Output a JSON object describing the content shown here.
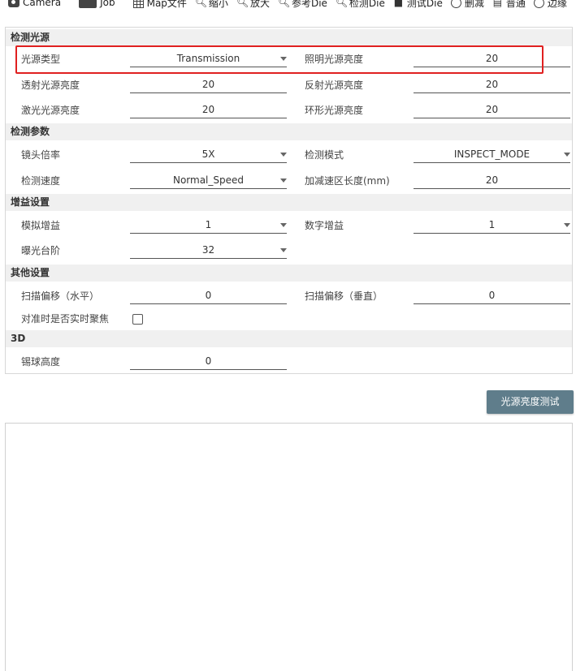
{
  "toolbar": {
    "items": [
      {
        "label": "Camera",
        "icon": "camera-icon"
      },
      {
        "label": "Job",
        "icon": "folder-icon"
      },
      {
        "label": "Map文件",
        "icon": "grid-icon"
      },
      {
        "label": "缩小",
        "icon": "zoom-out-icon"
      },
      {
        "label": "放大",
        "icon": "zoom-in-icon"
      },
      {
        "label": "参考Die",
        "icon": "search-icon"
      },
      {
        "label": "检测Die",
        "icon": "search-icon"
      },
      {
        "label": "测试Die",
        "icon": "bookmark-icon"
      },
      {
        "label": "删减",
        "icon": "minus-circle-icon"
      },
      {
        "label": "普通",
        "icon": "file-icon"
      },
      {
        "label": "边缘",
        "icon": "circle-icon"
      }
    ]
  },
  "sections": {
    "light": {
      "title": "检测光源",
      "light_type_label": "光源类型",
      "light_type_value": "Transmission",
      "illum_label": "照明光源亮度",
      "illum_value": "20",
      "trans_label": "透射光源亮度",
      "trans_value": "20",
      "reflect_label": "反射光源亮度",
      "reflect_value": "20",
      "laser_label": "激光光源亮度",
      "laser_value": "20",
      "ring_label": "环形光源亮度",
      "ring_value": "20"
    },
    "inspect": {
      "title": "检测参数",
      "lens_label": "镜头倍率",
      "lens_value": "5X",
      "mode_label": "检测模式",
      "mode_value": "INSPECT_MODE",
      "speed_label": "检测速度",
      "speed_value": "Normal_Speed",
      "accel_label": "加减速区长度(mm)",
      "accel_value": "20"
    },
    "gain": {
      "title": "增益设置",
      "analog_label": "模拟增益",
      "analog_value": "1",
      "digital_label": "数字增益",
      "digital_value": "1",
      "exposure_label": "曝光台阶",
      "exposure_value": "32"
    },
    "other": {
      "title": "其他设置",
      "scan_h_label": "扫描偏移（水平）",
      "scan_h_value": "0",
      "scan_v_label": "扫描偏移（垂直）",
      "scan_v_value": "0",
      "focus_label": "对准时是否实时聚焦",
      "focus_checked": false
    },
    "threed": {
      "title": "3D",
      "solder_label": "锡球高度",
      "solder_value": "0"
    }
  },
  "test_button_label": "光源亮度测试",
  "colors": {
    "highlight": "#e02020",
    "button_bg": "#5f7d8b",
    "section_bg": "#f0f0f0"
  }
}
